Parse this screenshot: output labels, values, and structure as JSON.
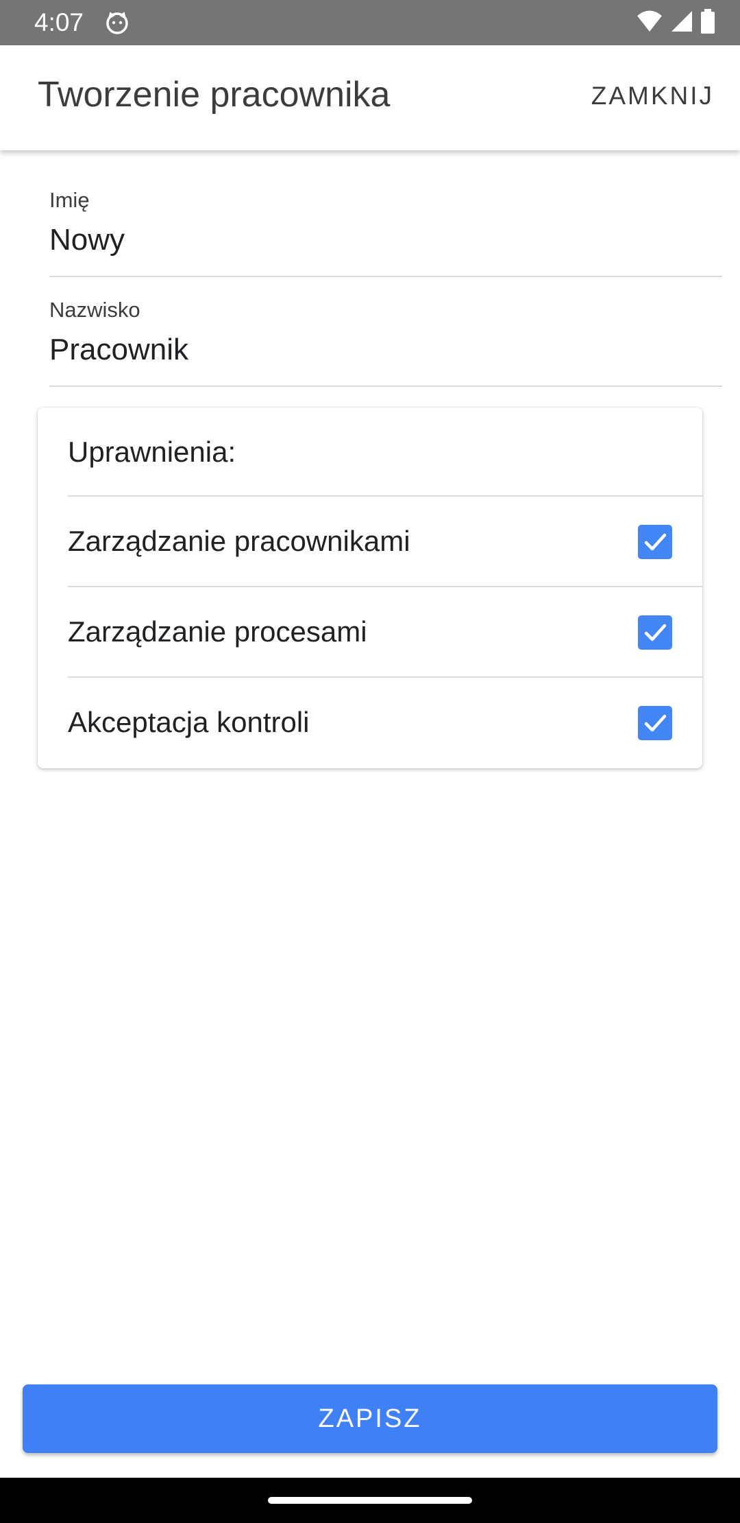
{
  "status_bar": {
    "time": "4:07",
    "icons": [
      "cat-notification-icon",
      "wifi-icon",
      "cell-signal-icon",
      "battery-icon"
    ]
  },
  "app_bar": {
    "title": "Tworzenie pracownika",
    "close_label": "ZAMKNIJ"
  },
  "form": {
    "first_name": {
      "label": "Imię",
      "value": "Nowy"
    },
    "last_name": {
      "label": "Nazwisko",
      "value": "Pracownik"
    }
  },
  "permissions": {
    "header": "Uprawnienia:",
    "items": [
      {
        "label": "Zarządzanie pracownikami",
        "checked": true
      },
      {
        "label": "Zarządzanie procesami",
        "checked": true
      },
      {
        "label": "Akceptacja kontroli",
        "checked": true
      }
    ]
  },
  "save_label": "ZAPISZ",
  "colors": {
    "accent": "#4285f4",
    "button": "#3f80f6",
    "status_bar": "#757575",
    "nav_bar": "#000000"
  }
}
